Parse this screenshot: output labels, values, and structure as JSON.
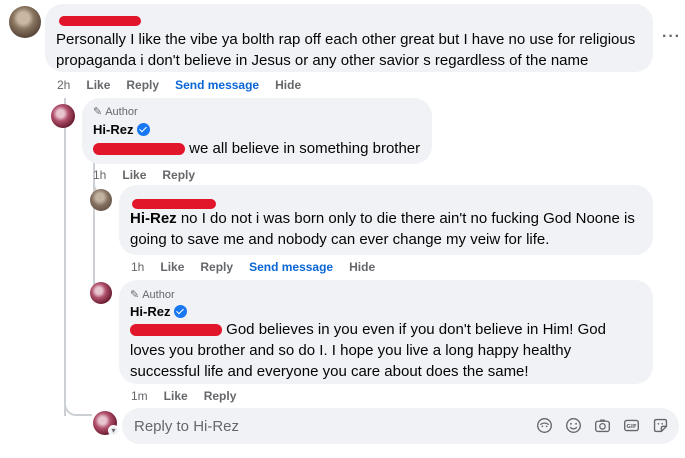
{
  "comment1": {
    "text": "Personally I like the vibe ya bolth rap off each other great but I have no use for religious propaganda i don't believe in Jesus or any other savior s regardless of the name",
    "time": "2h",
    "like": "Like",
    "reply": "Reply",
    "send_message": "Send message",
    "hide": "Hide",
    "more": "···"
  },
  "reply1": {
    "author_tag": "Author",
    "name": "Hi-Rez",
    "text": "we all believe in something brother",
    "time": "1h",
    "like": "Like",
    "reply": "Reply"
  },
  "reply2": {
    "mention": "Hi-Rez",
    "text": "no I do not i was born only to die there ain't no fucking God Noone is going to save me and nobody can ever change my veiw for life.",
    "time": "1h",
    "like": "Like",
    "reply": "Reply",
    "send_message": "Send message",
    "hide": "Hide"
  },
  "reply3": {
    "author_tag": "Author",
    "name": "Hi-Rez",
    "text": "God believes in you even if you don't believe in Him! God loves you brother and so do I. I hope you live a long happy healthy successful life and everyone you care about does the same!",
    "time": "1m",
    "like": "Like",
    "reply": "Reply"
  },
  "reply_box": {
    "placeholder": "Reply to Hi-Rez",
    "icons": [
      "avatar-sticker-icon",
      "emoji-icon",
      "camera-icon",
      "gif-icon",
      "sticker-icon"
    ]
  },
  "colors": {
    "redaction": "#e2162a",
    "link_blue": "#0a66d6",
    "verified": "#1877f2",
    "bubble": "#f0f2f5"
  }
}
